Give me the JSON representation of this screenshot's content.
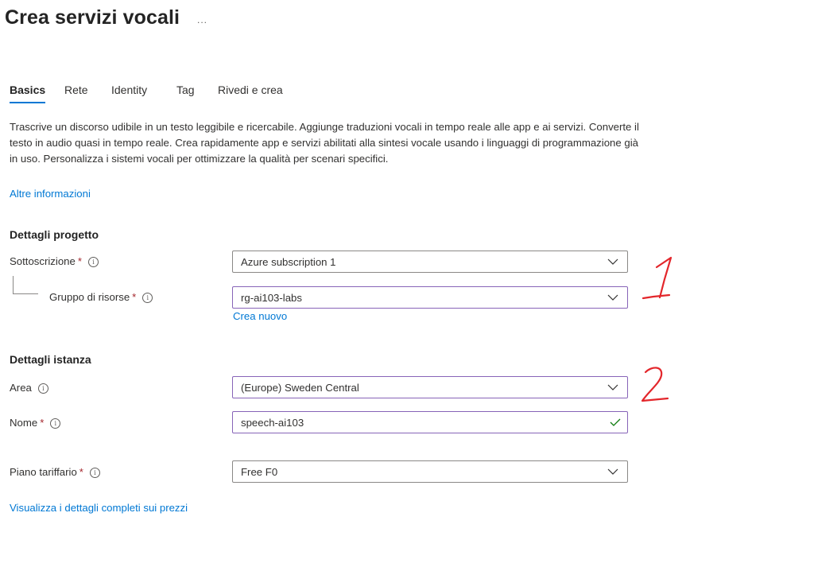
{
  "header": {
    "title": "Crea servizi vocali",
    "more": "..."
  },
  "tabs": [
    {
      "label": "Basics",
      "active": true
    },
    {
      "label": "Rete",
      "active": false
    },
    {
      "label": "Identity",
      "active": false
    },
    {
      "label": "Tag",
      "active": false
    },
    {
      "label": "Rivedi e crea",
      "active": false
    }
  ],
  "description": "Trascrive un discorso udibile in un testo leggibile e ricercabile. Aggiunge traduzioni vocali in tempo reale alle app e ai servizi. Converte il testo in audio quasi in tempo reale. Crea rapidamente app e servizi abilitati alla sintesi vocale usando i linguaggi di programmazione già in uso. Personalizza i sistemi vocali per ottimizzare la qualità per scenari specifici.",
  "learn_more": "Altre informazioni",
  "project": {
    "heading": "Dettagli progetto",
    "subscription": {
      "label": "Sottoscrizione",
      "required": "*",
      "info": "i",
      "value": "Azure subscription 1"
    },
    "resource_group": {
      "label": "Gruppo di risorse",
      "required": "*",
      "info": "i",
      "value": "rg-ai103-labs",
      "create_new": "Crea nuovo"
    }
  },
  "instance": {
    "heading": "Dettagli istanza",
    "area": {
      "label": "Area",
      "info": "i",
      "value": "(Europe) Sweden Central"
    },
    "name": {
      "label": "Nome",
      "required": "*",
      "info": "i",
      "value": "speech-ai103"
    },
    "pricing": {
      "label": "Piano tariffario",
      "required": "*",
      "info": "i",
      "value": "Free F0"
    },
    "pricing_link": "Visualizza i dettagli completi sui prezzi"
  },
  "annotations": [
    "1",
    "2"
  ],
  "colors": {
    "accent": "#0078d4",
    "focus_border": "#8764b8",
    "required": "#a4262c",
    "valid": "#107c10",
    "annotation": "#e3262b"
  },
  "icons": {
    "dropdown": "chevron-down-icon",
    "info": "info-icon",
    "valid": "checkmark-icon"
  }
}
